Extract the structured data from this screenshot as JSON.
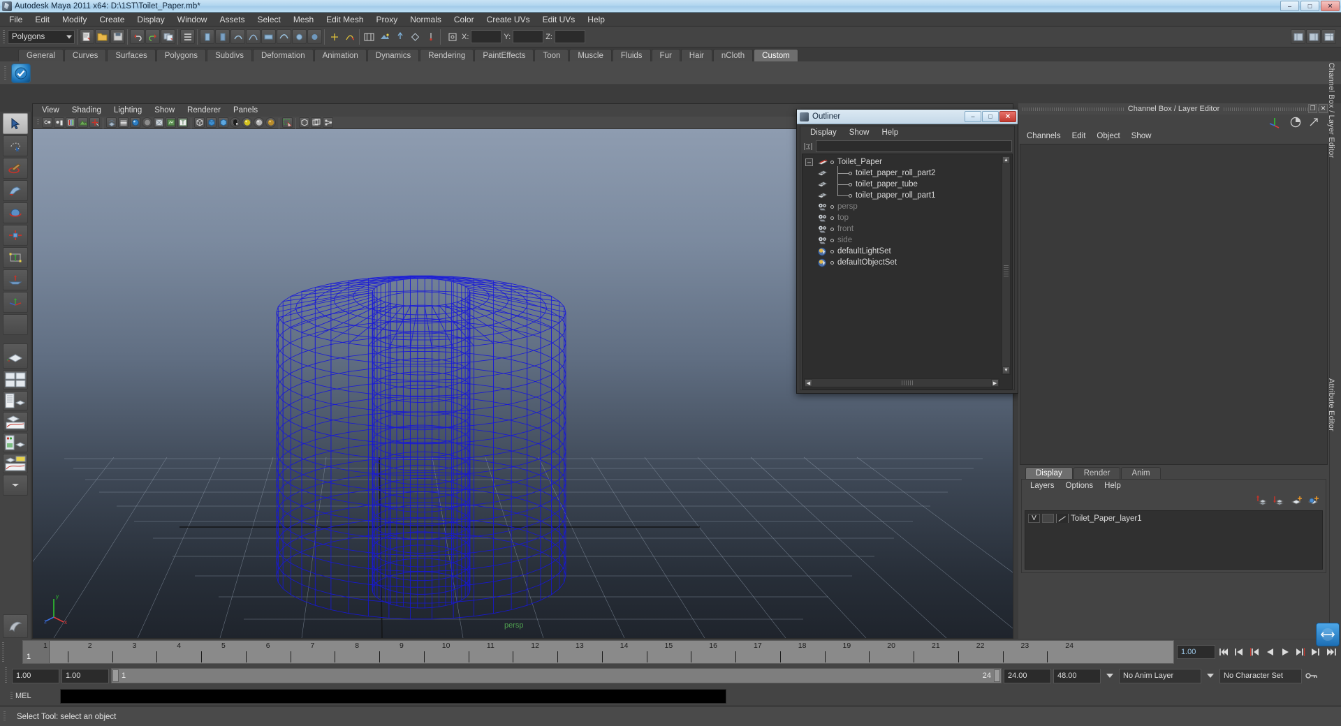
{
  "window": {
    "title": "Autodesk Maya 2011 x64: D:\\1ST\\Toilet_Paper.mb*",
    "minimize": "–",
    "maximize": "□",
    "close": "✕"
  },
  "menubar": {
    "items": [
      "File",
      "Edit",
      "Modify",
      "Create",
      "Display",
      "Window",
      "Assets",
      "Select",
      "Mesh",
      "Edit Mesh",
      "Proxy",
      "Normals",
      "Color",
      "Create UVs",
      "Edit UVs",
      "Help"
    ]
  },
  "statusline": {
    "mode_selector": "Polygons",
    "x_label": "X:",
    "y_label": "Y:",
    "z_label": "Z:",
    "x_value": "",
    "y_value": "",
    "z_value": ""
  },
  "shelf": {
    "tabs": [
      "General",
      "Curves",
      "Surfaces",
      "Polygons",
      "Subdivs",
      "Deformation",
      "Animation",
      "Dynamics",
      "Rendering",
      "PaintEffects",
      "Toon",
      "Muscle",
      "Fluids",
      "Fur",
      "Hair",
      "nCloth",
      "Custom"
    ],
    "active_tab": "Custom",
    "buttons": [
      "checkmark-shelf-button"
    ]
  },
  "toolbox": {
    "tools": [
      "select-tool",
      "lasso-select-tool",
      "paint-select-tool",
      "move-tool",
      "rotate-tool",
      "scale-tool",
      "universal-manipulator",
      "soft-modification-tool",
      "last-tool-used",
      "empty-slot"
    ],
    "layout_tools": [
      "single-perspective-view",
      "four-view-layout",
      "outliner-persp-layout",
      "persp-graph-layout",
      "hypershade-persp-layout",
      "persp-trax-layout",
      "more-layouts"
    ]
  },
  "viewport": {
    "menus": [
      "View",
      "Shading",
      "Lighting",
      "Show",
      "Renderer",
      "Panels"
    ],
    "camera_label": "persp",
    "axis_labels": {
      "x": "x",
      "y": "y",
      "z": "z"
    },
    "toolbar_icons": [
      "select-camera-icon",
      "camera-attributes-icon",
      "bookmarks-icon",
      "image-plane-icon",
      "two-d-pan-zoom-icon",
      "grid-icon",
      "film-gate-icon",
      "resolution-gate-icon",
      "gate-mask-icon",
      "xray-icon",
      "shading-smooth-icon",
      "texture-icon",
      "wireframe-icon",
      "smooth-shade-all-icon",
      "smooth-shade-textured-icon",
      "hardware-texturing-icon",
      "all-lights-icon",
      "default-light-icon",
      "shadows-icon",
      "isolate-select-icon",
      "xray-joints-icon",
      "xray-active-icon",
      "exposure-icon"
    ]
  },
  "outliner": {
    "title": "Outliner",
    "minimize": "–",
    "maximize": "□",
    "close": "✕",
    "menus": [
      "Display",
      "Show",
      "Help"
    ],
    "search_value": "",
    "items": [
      {
        "label": "Toilet_Paper",
        "icon": "transform-group-icon",
        "depth": 0,
        "expander": "–",
        "dim": false
      },
      {
        "label": "toilet_paper_roll_part2",
        "icon": "mesh-icon",
        "depth": 1,
        "dim": false
      },
      {
        "label": "toilet_paper_tube",
        "icon": "mesh-icon",
        "depth": 1,
        "dim": false
      },
      {
        "label": "toilet_paper_roll_part1",
        "icon": "mesh-icon",
        "depth": 1,
        "dim": false,
        "last": true
      },
      {
        "label": "persp",
        "icon": "camera-icon",
        "depth": 0,
        "dim": true
      },
      {
        "label": "top",
        "icon": "camera-icon",
        "depth": 0,
        "dim": true
      },
      {
        "label": "front",
        "icon": "camera-icon",
        "depth": 0,
        "dim": true
      },
      {
        "label": "side",
        "icon": "camera-icon",
        "depth": 0,
        "dim": true
      },
      {
        "label": "defaultLightSet",
        "icon": "set-icon",
        "depth": 0,
        "dim": false
      },
      {
        "label": "defaultObjectSet",
        "icon": "set-icon",
        "depth": 0,
        "dim": false
      }
    ]
  },
  "right_panel": {
    "title": "Channel Box / Layer Editor",
    "restore": "❐",
    "close": "✕",
    "header_icons": [
      "axis-manipulator-icon",
      "pie-toggle-icon",
      "arrow-expand-icon"
    ],
    "menus": [
      "Channels",
      "Edit",
      "Object",
      "Show"
    ],
    "dock_label_1": "Channel Box / Layer Editor",
    "dock_label_2": "Attribute Editor",
    "tabs": [
      "Display",
      "Render",
      "Anim"
    ],
    "active_tab": "Display",
    "layer_menus": [
      "Layers",
      "Options",
      "Help"
    ],
    "layer_icons": [
      "move-layer-up-icon",
      "move-layer-down-icon",
      "new-layer-icon",
      "new-layer-from-selected-icon"
    ],
    "layers": [
      {
        "visibility": "V",
        "playback": "",
        "name": "Toilet_Paper_layer1"
      }
    ]
  },
  "timeslider": {
    "ticks": [
      "1",
      "2",
      "3",
      "4",
      "5",
      "6",
      "7",
      "8",
      "9",
      "10",
      "11",
      "12",
      "13",
      "14",
      "15",
      "16",
      "17",
      "18",
      "19",
      "20",
      "21",
      "22",
      "23",
      "24"
    ],
    "current_frame": "1",
    "current_field": "1.00",
    "playback_buttons": [
      "go-to-start-icon",
      "step-back-keyframe-icon",
      "step-back-frame-icon",
      "play-backwards-icon",
      "play-forwards-icon",
      "step-forward-frame-icon",
      "step-forward-keyframe-icon",
      "go-to-end-icon"
    ]
  },
  "rangeslider": {
    "anim_start": "1.00",
    "range_start": "1.00",
    "bar_start_label": "1",
    "bar_end_label": "24",
    "range_end": "24.00",
    "anim_end": "48.00",
    "anim_layer": "No Anim Layer",
    "character_set": "No Character Set",
    "key_icon": "key-icon"
  },
  "commandline": {
    "language_label": "MEL",
    "input_value": ""
  },
  "statusbar": {
    "message": "Select Tool: select an object"
  },
  "colors": {
    "wireframe_blue": "#1414d8",
    "title_gradient_top": "#c9e3f5",
    "accent_green": "#4fa04f",
    "panel_bg": "#444444",
    "viewport_top": "#8a99ad",
    "viewport_bottom": "#232a33"
  }
}
